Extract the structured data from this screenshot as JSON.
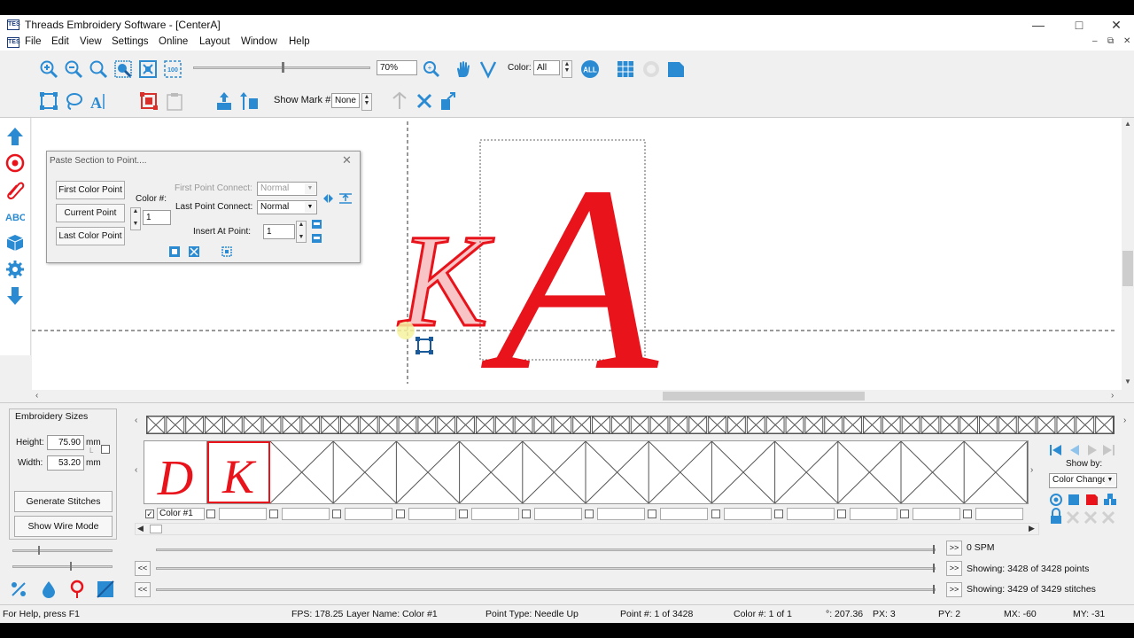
{
  "window": {
    "title": "Threads Embroidery Software - [CenterA]",
    "app_icon_text": "TES",
    "controls": [
      "minimize",
      "maximize",
      "close"
    ]
  },
  "menu": {
    "items": [
      "File",
      "Edit",
      "View",
      "Settings",
      "Online",
      "Layout",
      "Window",
      "Help"
    ]
  },
  "toolbar1": {
    "zoom_value": "70%",
    "color_label": "Color:",
    "color_value": "All",
    "zoom_slider_fraction": 0.5,
    "icons": [
      "zoom-in-icon",
      "zoom-out-icon",
      "zoom-icon",
      "zoom-to-selection-icon",
      "fit-to-window-icon",
      "zoom-100-icon",
      "zoom-options-icon",
      "hand-pan-icon",
      "select-icon",
      "all-colors-icon",
      "grid-icon",
      "hoop-icon",
      "background-icon"
    ]
  },
  "toolbar2": {
    "show_mark_label": "Show Mark #:",
    "show_mark_value": "None",
    "icons": [
      "select-rect-icon",
      "lasso-icon",
      "text-tool-icon",
      "group-icon",
      "clipboard-icon",
      "align-top-icon",
      "align-vertical-icon",
      "mark-icon",
      "remove-mark-icon",
      "goto-mark-icon"
    ]
  },
  "left_tools": [
    "arrow-up-icon",
    "target-icon",
    "paperclip-icon",
    "abc-icon",
    "cube-icon",
    "gear-icon",
    "arrow-down-icon"
  ],
  "dialog": {
    "title": "Paste Section to Point....",
    "buttons": {
      "first_color_point": "First Color Point",
      "current_point": "Current Point",
      "last_color_point": "Last Color Point"
    },
    "color_label": "Color #:",
    "color_value": "1",
    "first_point_connect_label": "First Point Connect:",
    "first_point_connect_value": "Normal",
    "last_point_connect_label": "Last Point Connect:",
    "last_point_connect_value": "Normal",
    "insert_at_point_label": "Insert At Point:",
    "insert_at_point_value": "1"
  },
  "canvas": {
    "letters": [
      "K",
      "A"
    ]
  },
  "embroidery_sizes": {
    "title": "Embroidery Sizes",
    "height_label": "Height:",
    "height_value": "75.90",
    "height_unit": "mm",
    "width_label": "Width:",
    "width_value": "53.20",
    "width_unit": "mm",
    "lock_label": "L",
    "generate_button": "Generate Stitches",
    "wire_button": "Show Wire Mode"
  },
  "swatches": {
    "letters": [
      "D",
      "K"
    ],
    "first_label": "Color #1"
  },
  "right_panel": {
    "show_by_label": "Show by:",
    "show_by_value": "Color Change"
  },
  "playback": {
    "spm": "0 SPM",
    "points_info": "Showing: 3428 of 3428 points",
    "stitches_info": "Showing: 3429 of 3429 stitches",
    "prev_label": "<<",
    "next_label": ">>"
  },
  "status": {
    "help": "For Help, press F1",
    "fps": "FPS: 178.25",
    "layer": "Layer Name: Color #1",
    "point_type": "Point Type: Needle Up",
    "point_num": "Point #: 1 of 3428",
    "color_num": "Color #: 1 of 1",
    "angle": "°: 207.36",
    "px": "PX: 3",
    "py": "PY: 2",
    "mx": "MX: -60",
    "my": "MY: -31"
  },
  "colors": {
    "accent": "#2a8bd3",
    "thread": "#e8131b"
  }
}
